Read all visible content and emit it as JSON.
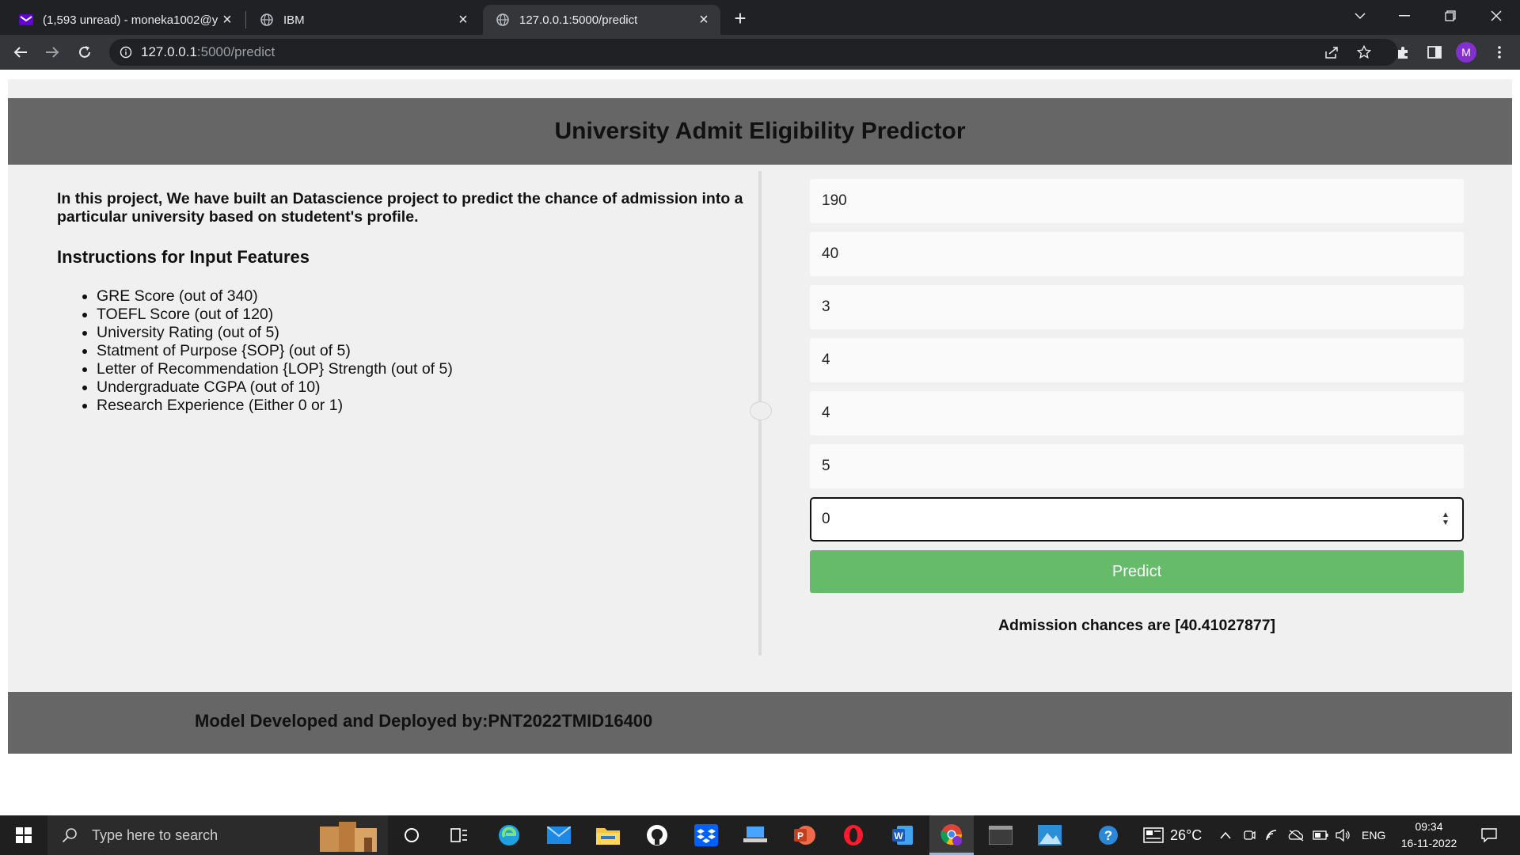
{
  "browser": {
    "tabs": [
      {
        "title": "(1,593 unread) - moneka1002@y",
        "icon": "yahoo-mail-icon"
      },
      {
        "title": "IBM",
        "icon": "globe-icon"
      },
      {
        "title": "127.0.0.1:5000/predict",
        "icon": "globe-icon"
      }
    ],
    "url_host": "127.0.0.1",
    "url_path": ":5000/predict",
    "profile_initial": "M"
  },
  "page": {
    "title": "University Admit Eligibility Predictor",
    "intro": "In this project, We have built an Datascience project to predict the chance of admission into a particular university based on studetent's profile.",
    "instructions_title": "Instructions for Input Features",
    "features": [
      "GRE Score (out of 340)",
      "TOEFL Score (out of 120)",
      "University Rating (out of 5)",
      "Statment of Purpose {SOP} (out of 5)",
      "Letter of Recommendation {LOP} Strength (out of 5)",
      "Undergraduate CGPA (out of 10)",
      "Research Experience (Either 0 or 1)"
    ],
    "inputs": [
      "190",
      "40",
      "3",
      "4",
      "4",
      "5",
      "0"
    ],
    "predict_label": "Predict",
    "result": "Admission chances are [40.41027877]",
    "footer": "Model Developed and Deployed by:PNT2022TMID16400"
  },
  "taskbar": {
    "search_placeholder": "Type here to search",
    "weather": "26°C",
    "language": "ENG",
    "time": "09:34",
    "date": "16-11-2022"
  }
}
